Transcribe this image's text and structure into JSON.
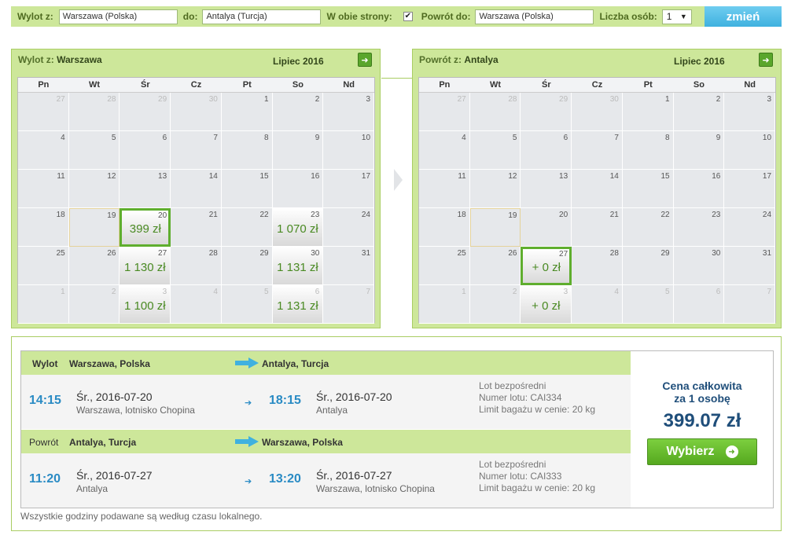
{
  "search": {
    "from_label": "Wylot z:",
    "from_value": "Warszawa (Polska)",
    "to_label": "do:",
    "to_value": "Antalya (Turcja)",
    "roundtrip_label": "W obie strony:",
    "roundtrip_checked": "✔",
    "return_label": "Powrót do:",
    "return_value": "Warszawa (Polska)",
    "persons_label": "Liczba osób:",
    "persons_value": "1",
    "submit_label": "zmień"
  },
  "calendars": [
    {
      "title_prefix": "Wylot z:",
      "title_city": "Warszawa",
      "month": "Lipiec 2016",
      "next_icon": "arrow-right-icon",
      "weekdays": [
        "Pn",
        "Wt",
        "Śr",
        "Cz",
        "Pt",
        "So",
        "Nd"
      ],
      "weeks": [
        [
          {
            "d": "27",
            "o": true
          },
          {
            "d": "28",
            "o": true
          },
          {
            "d": "29",
            "o": true
          },
          {
            "d": "30",
            "o": true
          },
          {
            "d": "1"
          },
          {
            "d": "2"
          },
          {
            "d": "3"
          }
        ],
        [
          {
            "d": "4"
          },
          {
            "d": "5"
          },
          {
            "d": "6"
          },
          {
            "d": "7"
          },
          {
            "d": "8"
          },
          {
            "d": "9"
          },
          {
            "d": "10"
          }
        ],
        [
          {
            "d": "11"
          },
          {
            "d": "12"
          },
          {
            "d": "13"
          },
          {
            "d": "14"
          },
          {
            "d": "15"
          },
          {
            "d": "16"
          },
          {
            "d": "17"
          }
        ],
        [
          {
            "d": "18"
          },
          {
            "d": "19",
            "today": true
          },
          {
            "d": "20",
            "p": "399 zł",
            "sel": true
          },
          {
            "d": "21"
          },
          {
            "d": "22"
          },
          {
            "d": "23",
            "p": "1 070 zł"
          },
          {
            "d": "24"
          }
        ],
        [
          {
            "d": "25"
          },
          {
            "d": "26"
          },
          {
            "d": "27",
            "p": "1 130 zł"
          },
          {
            "d": "28"
          },
          {
            "d": "29"
          },
          {
            "d": "30",
            "p": "1 131 zł"
          },
          {
            "d": "31"
          }
        ],
        [
          {
            "d": "1",
            "o": true
          },
          {
            "d": "2",
            "o": true
          },
          {
            "d": "3",
            "o": true,
            "p": "1 100 zł"
          },
          {
            "d": "4",
            "o": true
          },
          {
            "d": "5",
            "o": true
          },
          {
            "d": "6",
            "o": true,
            "p": "1 131 zł"
          },
          {
            "d": "7",
            "o": true
          }
        ]
      ]
    },
    {
      "title_prefix": "Powrót z:",
      "title_city": "Antalya",
      "month": "Lipiec 2016",
      "next_icon": "arrow-right-icon",
      "weekdays": [
        "Pn",
        "Wt",
        "Śr",
        "Cz",
        "Pt",
        "So",
        "Nd"
      ],
      "weeks": [
        [
          {
            "d": "27",
            "o": true
          },
          {
            "d": "28",
            "o": true
          },
          {
            "d": "29",
            "o": true
          },
          {
            "d": "30",
            "o": true
          },
          {
            "d": "1"
          },
          {
            "d": "2"
          },
          {
            "d": "3"
          }
        ],
        [
          {
            "d": "4"
          },
          {
            "d": "5"
          },
          {
            "d": "6"
          },
          {
            "d": "7"
          },
          {
            "d": "8"
          },
          {
            "d": "9"
          },
          {
            "d": "10"
          }
        ],
        [
          {
            "d": "11"
          },
          {
            "d": "12"
          },
          {
            "d": "13"
          },
          {
            "d": "14"
          },
          {
            "d": "15"
          },
          {
            "d": "16"
          },
          {
            "d": "17"
          }
        ],
        [
          {
            "d": "18"
          },
          {
            "d": "19",
            "today": true
          },
          {
            "d": "20"
          },
          {
            "d": "21"
          },
          {
            "d": "22"
          },
          {
            "d": "23"
          },
          {
            "d": "24"
          }
        ],
        [
          {
            "d": "25"
          },
          {
            "d": "26"
          },
          {
            "d": "27",
            "p": "+ 0 zł",
            "sel": true
          },
          {
            "d": "28"
          },
          {
            "d": "29"
          },
          {
            "d": "30"
          },
          {
            "d": "31"
          }
        ],
        [
          {
            "d": "1",
            "o": true
          },
          {
            "d": "2",
            "o": true
          },
          {
            "d": "3",
            "o": true,
            "p": "+ 0 zł"
          },
          {
            "d": "4",
            "o": true
          },
          {
            "d": "5",
            "o": true
          },
          {
            "d": "6",
            "o": true
          },
          {
            "d": "7",
            "o": true
          }
        ]
      ]
    }
  ],
  "outbound": {
    "label": "Wylot",
    "from": "Warszawa, Polska",
    "to": "Antalya, Turcja",
    "dep_time": "14:15",
    "dep_date": "Śr., 2016-07-20",
    "dep_place": "Warszawa, lotnisko Chopina",
    "arr_time": "18:15",
    "arr_date": "Śr., 2016-07-20",
    "arr_place": "Antalya",
    "flight_type": "Lot bezpośredni",
    "flight_no": "Numer lotu: CAI334",
    "baggage": "Limit bagażu w cenie: 20 kg"
  },
  "inbound": {
    "label": "Powrót",
    "from": "Antalya, Turcja",
    "to": "Warszawa, Polska",
    "dep_time": "11:20",
    "dep_date": "Śr., 2016-07-27",
    "dep_place": "Antalya",
    "arr_time": "13:20",
    "arr_date": "Śr., 2016-07-27",
    "arr_place": "Warszawa, lotnisko Chopina",
    "flight_type": "Lot bezpośredni",
    "flight_no": "Numer lotu: CAI333",
    "baggage": "Limit bagażu w cenie: 20 kg"
  },
  "price": {
    "label_line1": "Cena całkowita",
    "label_line2": "za 1 osobę",
    "total": "399.07 zł",
    "select_label": "Wybierz"
  },
  "footnote": "Wszystkie godziny podawane są według czasu lokalnego.",
  "colors": {
    "accent_green": "#cde79a",
    "price_green": "#4a8a23",
    "time_blue": "#2a8bc4",
    "button_blue": "#3fb1df",
    "total_navy": "#1f4e7a"
  }
}
